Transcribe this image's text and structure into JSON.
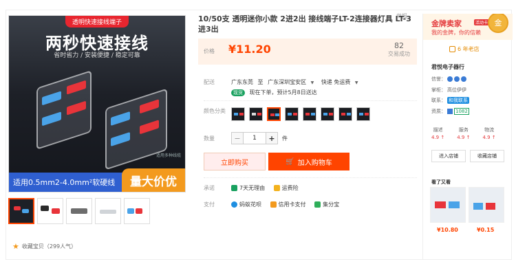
{
  "report_label": "举报",
  "gallery": {
    "top_tag": "透明快速接线端子",
    "headline": "两秒快速接线",
    "sub": "省时省力 / 安装便捷 / 稳定可靠",
    "tagline": "适用多种线缆",
    "spec": "适用0.5mm2-4.0mm²软硬线",
    "promo": "量大价优",
    "favorite": "收藏宝贝（299人气）"
  },
  "product": {
    "title": "10/50支 透明迷你小款 2进2出 接线端子LT-2连接器灯具 LT-3进3出",
    "price_label": "价格",
    "price": "¥11.20",
    "sales_count": "82",
    "sales_label": "交易成功",
    "shipping_label": "配送",
    "ship_from": "广东东莞",
    "ship_to_word": "至",
    "ship_to": "广东深圳宝安区",
    "ship_method": "快递 免运费",
    "ship_badge": "现货",
    "ship_note": "现在下单，预计5月8日送达",
    "color_label": "颜色分类",
    "qty_label": "数量",
    "qty_value": "1",
    "qty_unit": "件",
    "buy_now": "立即购买",
    "add_cart": "加入购物车",
    "promise_label": "承诺",
    "promises": [
      "7天无理由",
      "运费险"
    ],
    "pay_label": "支付",
    "payments": [
      "蚂蚁花呗",
      "信用卡支付",
      "集分宝"
    ]
  },
  "seller": {
    "gold_title": "金牌卖家",
    "gold_tag": "活动卡号",
    "gold_sub": "我的金牌，你的信赖",
    "medal": "金",
    "years": "6 年老店",
    "shop_name": "君悦电子器行",
    "credit_label": "信誉：",
    "keeper_label": "掌柜：",
    "keeper": "高位伊伊",
    "contact_label": "联系：",
    "contact": "和我联系",
    "qual_label": "资质：",
    "qual_value": "1082",
    "score_labels": [
      "描述",
      "服务",
      "物流"
    ],
    "score_values": [
      "4.9 ↑",
      "4.9 ↑",
      "4.9 ↑"
    ],
    "enter_shop": "进入店铺",
    "fav_shop": "收藏店铺",
    "recommend_title": "看了又看",
    "recommend_prices": [
      "¥10.80",
      "¥0.15"
    ]
  },
  "colors": {
    "accent": "#ff4400",
    "gold": "#e4393c",
    "price_bg": "#fff2e8"
  }
}
